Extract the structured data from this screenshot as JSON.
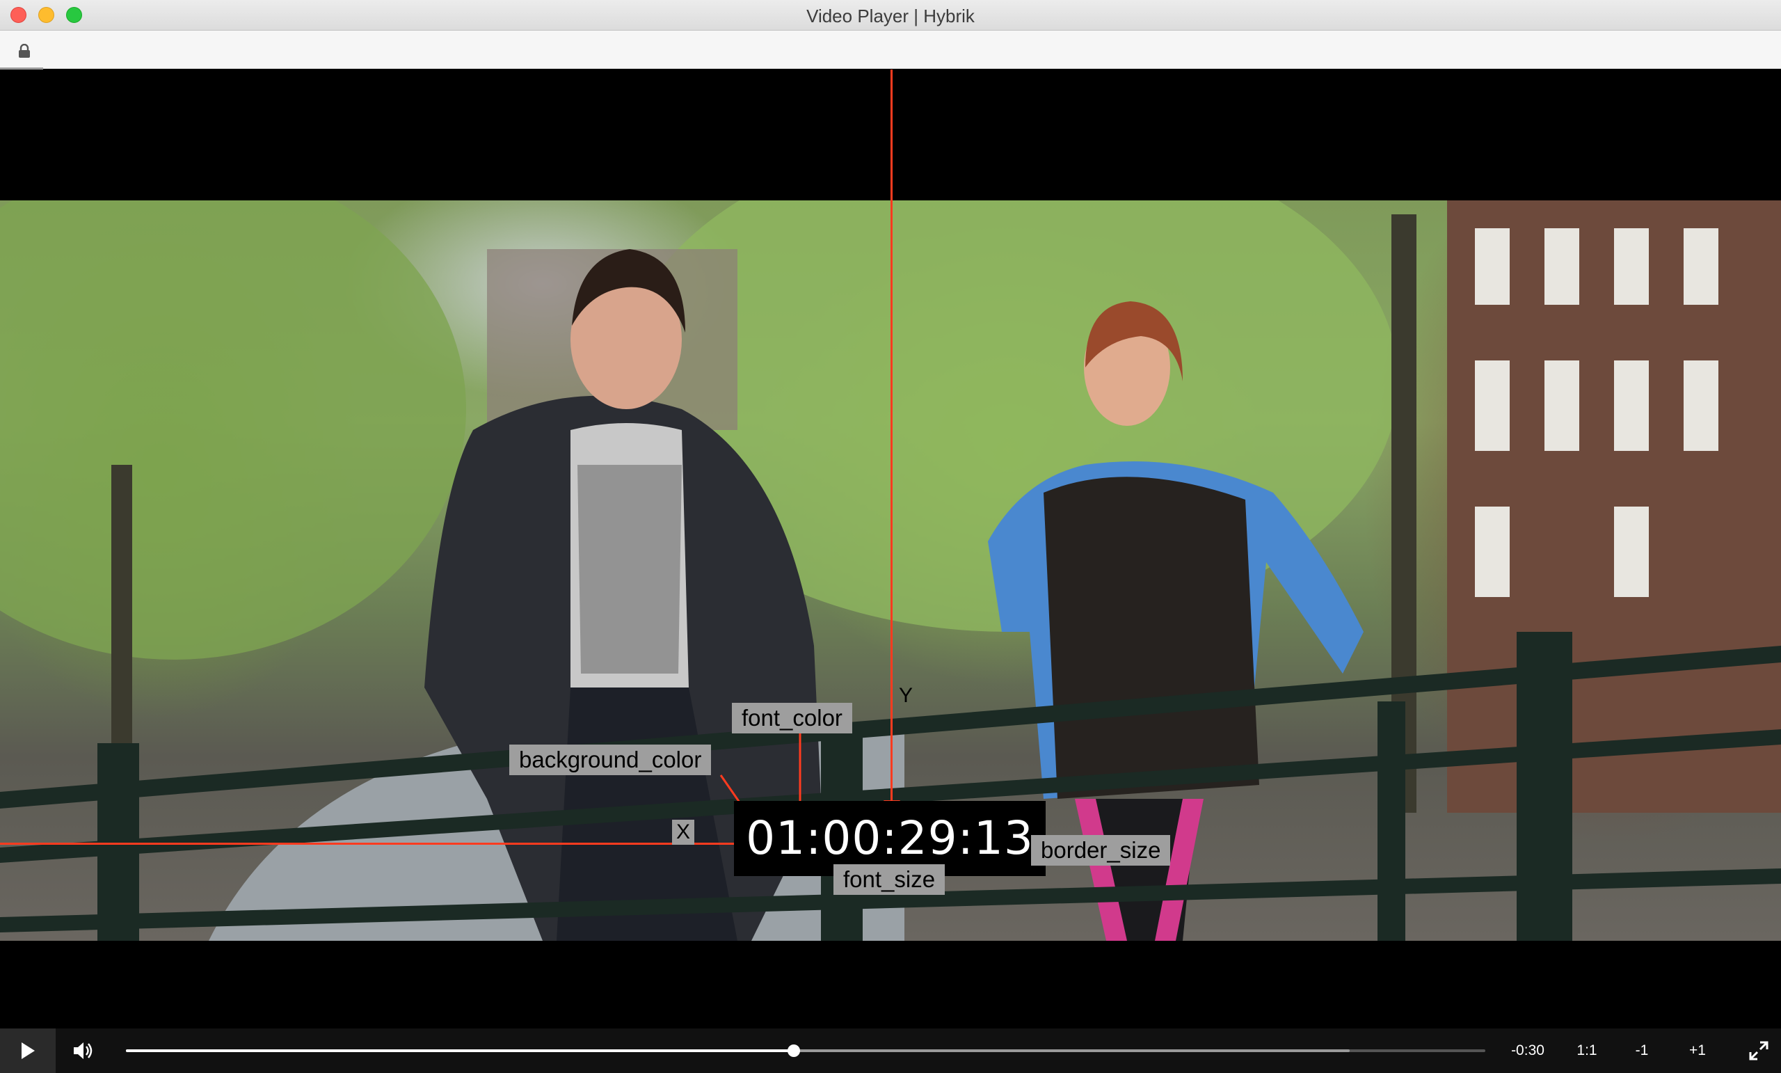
{
  "window": {
    "title": "Video Player | Hybrik"
  },
  "addressbar": {
    "icon": "lock-icon"
  },
  "overlay": {
    "timecode": "01:00:29:13",
    "labels": {
      "background_color": "background_color",
      "font_color": "font_color",
      "font_size": "font_size",
      "border_size": "border_size",
      "x": "X",
      "y": "Y"
    },
    "guide_color": "#ff3b1f"
  },
  "controls": {
    "play_icon": "play-icon",
    "volume_icon": "volume-icon",
    "played_fraction": 0.4915,
    "buffered_fraction": 0.9,
    "time_remaining": "-0:30",
    "aspect_ratio": "1:1",
    "step_back": "-1",
    "step_forward": "+1",
    "fullscreen_icon": "fullscreen-icon"
  }
}
